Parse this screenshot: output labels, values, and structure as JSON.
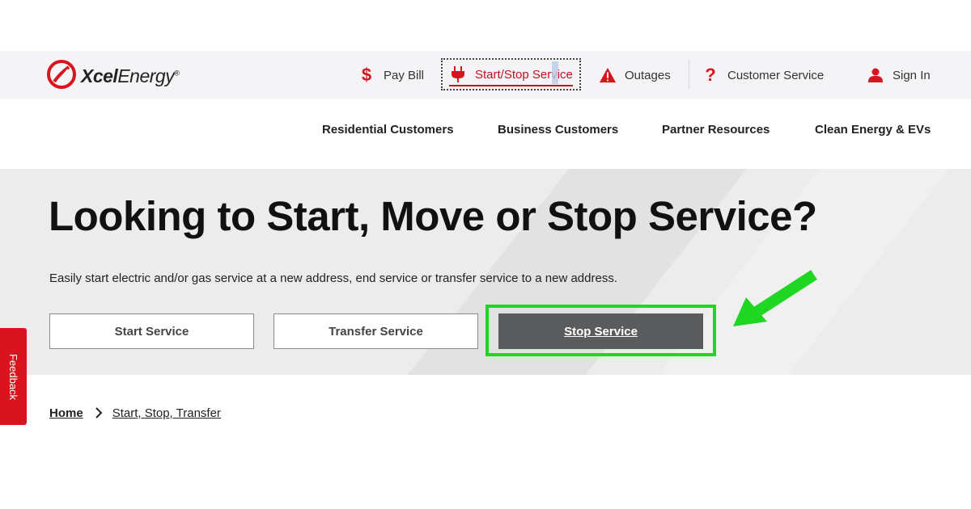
{
  "brand": {
    "name_bold": "Xcel",
    "name_light": "Energy",
    "mark": "®"
  },
  "utility_nav": {
    "pay_bill": "Pay Bill",
    "start_stop": "Start/Stop Service",
    "outages": "Outages",
    "customer_service": "Customer Service",
    "sign_in": "Sign In"
  },
  "main_nav": [
    "Residential Customers",
    "Business Customers",
    "Partner Resources",
    "Clean Energy & EVs"
  ],
  "hero": {
    "title": "Looking to Start, Move or Stop Service?",
    "subtitle": "Easily start electric and/or gas service at a new address, end service or transfer service to a new address.",
    "buttons": {
      "start": "Start Service",
      "transfer": "Transfer Service",
      "stop": "Stop Service"
    }
  },
  "feedback_label": "Feedback",
  "breadcrumb": {
    "home": "Home",
    "current": "Start, Stop, Transfer"
  },
  "colors": {
    "brand_red": "#c5101f",
    "highlight_green": "#1fd622",
    "stop_button": "#5a5b5d",
    "hero_bg": "#ececec"
  },
  "icons": [
    "xcel-logo-icon",
    "dollar-icon",
    "plug-icon",
    "warning-icon",
    "question-icon",
    "user-icon",
    "chevron-right-icon",
    "green-arrow-icon"
  ]
}
